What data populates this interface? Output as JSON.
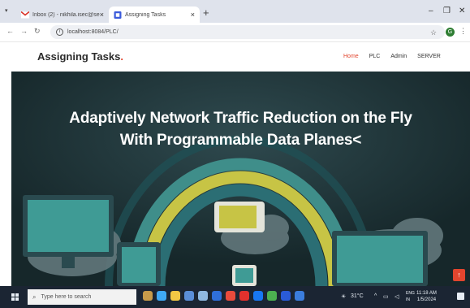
{
  "browser": {
    "tabs": [
      {
        "title": "Inbox (2) - nikhila.isec@sebpo...",
        "active": false,
        "favicon": "gmail-icon"
      },
      {
        "title": "Assigning Tasks",
        "active": true,
        "favicon": "page-icon"
      }
    ],
    "url": "localhost:8084/PLC/",
    "profile_initial": "G"
  },
  "site": {
    "brand": "Assigning Tasks",
    "brand_suffix": ".",
    "nav": [
      "Home",
      "PLC",
      "Admin",
      "SERVER"
    ],
    "active_nav": "Home",
    "hero_line1": "Adaptively Network Traffic Reduction on the Fly",
    "hero_line2": "With Programmable Data Planes<"
  },
  "taskbar": {
    "search_placeholder": "Type here to search",
    "weather": "31°C",
    "lang": "ENG",
    "region": "IN",
    "time": "11:18 AM",
    "date": "1/5/2024"
  },
  "colors": {
    "accent": "#e2452e",
    "hero_bg": "#1c3034",
    "taskbar": "#1b2533"
  }
}
